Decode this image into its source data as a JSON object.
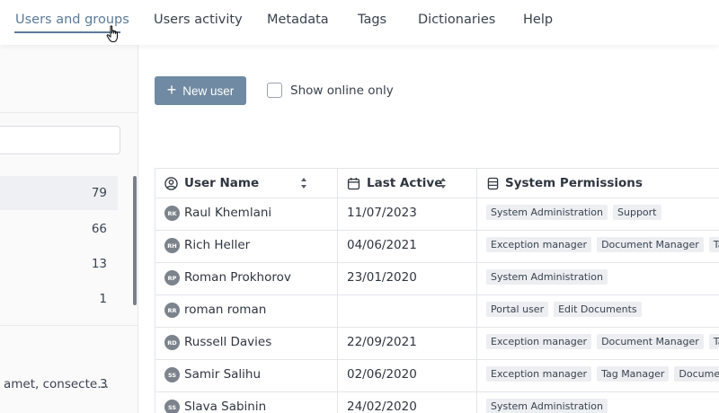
{
  "nav": {
    "tabs": [
      {
        "label": "Users and groups",
        "active": true
      },
      {
        "label": "Users activity"
      },
      {
        "label": "Metadata"
      },
      {
        "label": "Tags"
      },
      {
        "label": "Dictionaries"
      },
      {
        "label": "Help"
      }
    ],
    "accent_color": "#5b7a98"
  },
  "left_panel": {
    "search": {
      "value": "",
      "placeholder": ""
    },
    "counts": [
      "79",
      "66",
      "13",
      "1"
    ],
    "group_item": {
      "text": "amet, consecte...",
      "count": "3"
    }
  },
  "toolbar": {
    "new_user_label": "New user",
    "show_online_label": "Show online only",
    "show_online_checked": false,
    "button_color": "#6f8aa2"
  },
  "table": {
    "headers": {
      "user_name": "User Name",
      "last_active": "Last Active",
      "permissions": "System Permissions"
    },
    "rows": [
      {
        "initials": "RK",
        "name": "Raul Khemlani",
        "last_active": "11/07/2023",
        "permissions": [
          "System Administration",
          "Support"
        ]
      },
      {
        "initials": "RH",
        "name": "Rich Heller",
        "last_active": "04/06/2021",
        "permissions": [
          "Exception manager",
          "Document Manager",
          "Tag M"
        ]
      },
      {
        "initials": "RP",
        "name": "Roman Prokhorov",
        "last_active": "23/01/2020",
        "permissions": [
          "System Administration"
        ]
      },
      {
        "initials": "RR",
        "name": "roman roman",
        "last_active": "",
        "permissions": [
          "Portal user",
          "Edit Documents"
        ]
      },
      {
        "initials": "RD",
        "name": "Russell Davies",
        "last_active": "22/09/2021",
        "permissions": [
          "Exception manager",
          "Document Manager",
          "Tag M"
        ]
      },
      {
        "initials": "SS",
        "name": "Samir Salihu",
        "last_active": "02/06/2020",
        "permissions": [
          "Exception manager",
          "Tag Manager",
          "Document M"
        ]
      },
      {
        "initials": "SS",
        "name": "Slava Sabinin",
        "last_active": "24/02/2020",
        "permissions": [
          "System Administration"
        ]
      }
    ]
  }
}
